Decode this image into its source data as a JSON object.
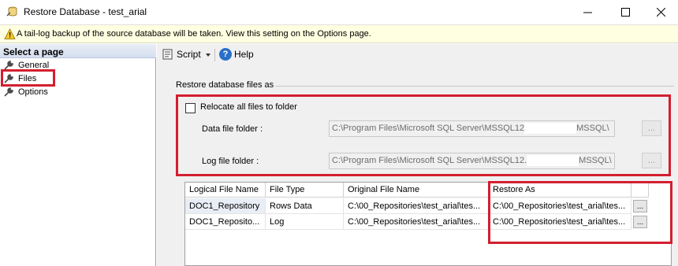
{
  "window": {
    "title": "Restore Database - test_arial",
    "icons": {
      "app": "restore-database-icon",
      "minimize": "minimize-icon",
      "maximize": "maximize-icon",
      "close": "close-icon"
    }
  },
  "warning": {
    "icon": "warning-icon",
    "text": "A tail-log backup of the source database will be taken. View this setting on the Options page."
  },
  "left_pane": {
    "header": "Select a page",
    "items": [
      {
        "label": "General",
        "icon": "wrench-icon"
      },
      {
        "label": "Files",
        "icon": "wrench-icon",
        "selected": true
      },
      {
        "label": "Options",
        "icon": "wrench-icon"
      }
    ]
  },
  "toolbar": {
    "script_label": "Script",
    "help_label": "Help",
    "help_glyph": "?"
  },
  "files": {
    "section_label": "Restore database files as",
    "relocate_label": "Relocate all files to folder",
    "relocate_checked": false,
    "data_folder_label": "Data file folder :",
    "data_folder_value_part1": "C:\\Program Files\\Microsoft SQL Server\\MSSQL12",
    "data_folder_value_part2": "MSSQL\\",
    "log_folder_label": "Log file folder :",
    "log_folder_value_part1": "C:\\Program Files\\Microsoft SQL Server\\MSSQL12.",
    "log_folder_value_part2": "MSSQL\\",
    "browse_label": "..."
  },
  "grid": {
    "columns": [
      "Logical File Name",
      "File Type",
      "Original File Name",
      "Restore As"
    ],
    "rows": [
      [
        "DOC1_Repository",
        "Rows Data",
        "C:\\00_Repositories\\test_arial\\tes...",
        "C:\\00_Repositories\\test_arial\\tes..."
      ],
      [
        "DOC1_Reposito...",
        "Log",
        "C:\\00_Repositories\\test_arial\\tes...",
        "C:\\00_Repositories\\test_arial\\tes..."
      ]
    ],
    "row_button_label": "..."
  },
  "colors": {
    "highlight_red": "#d31f2f",
    "warning_bg": "#ffffe1",
    "pane_bg": "#f0f0f0"
  }
}
